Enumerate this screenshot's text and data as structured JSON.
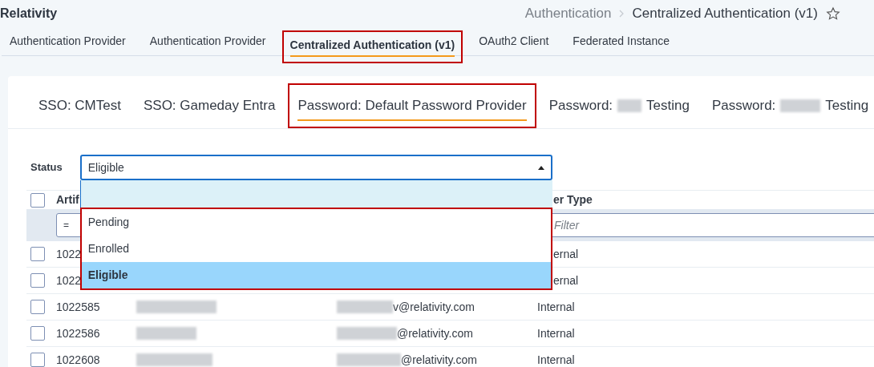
{
  "app_title": "Relativity",
  "breadcrumb": {
    "parent": "Authentication",
    "current": "Centralized Authentication (v1)",
    "favorite": false
  },
  "tabs": [
    {
      "label": "Authentication Provider",
      "selected": false,
      "highlighted": false
    },
    {
      "label": "Authentication Provider",
      "selected": false,
      "highlighted": false
    },
    {
      "label": "Centralized Authentication (v1)",
      "selected": true,
      "highlighted": true
    },
    {
      "label": "OAuth2 Client",
      "selected": false,
      "highlighted": false
    },
    {
      "label": "Federated Instance",
      "selected": false,
      "highlighted": false
    }
  ],
  "subtabs": [
    {
      "label": "SSO: CMTest",
      "selected": false,
      "highlighted": false
    },
    {
      "label": "SSO: Gameday Entra",
      "selected": false,
      "highlighted": false
    },
    {
      "label": "Password: Default Password Provider",
      "selected": true,
      "highlighted": true
    },
    {
      "label": "Password:",
      "label_end": "Testing",
      "redacted": true,
      "selected": false,
      "highlighted": false
    },
    {
      "label": "Password:",
      "label_end": "Testing",
      "redacted": true,
      "selected": false,
      "highlighted": false
    }
  ],
  "status_filter": {
    "label": "Status",
    "value": "Eligible",
    "open": true,
    "options_highlighted": true,
    "options": [
      {
        "label": "Pending",
        "selected": false
      },
      {
        "label": "Enrolled",
        "selected": false
      },
      {
        "label": "Eligible",
        "selected": true
      }
    ]
  },
  "table": {
    "columns": [
      "Artif",
      "er Type"
    ],
    "select_all_checked": false,
    "filter_row": {
      "operator": "=",
      "placeholder": "Filter"
    },
    "rows": [
      {
        "artifact_id": "1022",
        "user_type": "ernal",
        "checked": false
      },
      {
        "artifact_id": "1022",
        "user_type": "ernal",
        "checked": false
      },
      {
        "artifact_id": "1022585",
        "name_redacted": true,
        "email": "v@relativity.com",
        "user_type": "Internal",
        "checked": false
      },
      {
        "artifact_id": "1022586",
        "name_redacted": true,
        "email": "@relativity.com",
        "user_type": "Internal",
        "checked": false
      },
      {
        "artifact_id": "1022608",
        "name_redacted": true,
        "email": "@relativity.com",
        "user_type": "Internal",
        "checked": false
      }
    ]
  }
}
